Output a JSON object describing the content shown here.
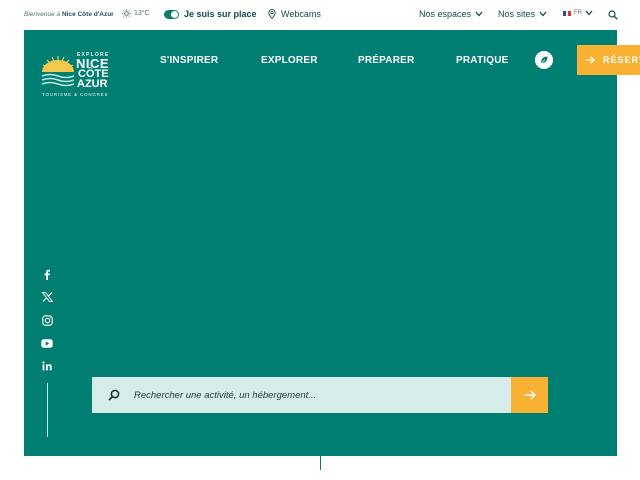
{
  "topbar": {
    "welcome_prefix": "Bienvenue à",
    "welcome_place": "Nice Côte d'Azur",
    "temperature": "13°C",
    "local_toggle": "Je suis sur place",
    "webcams": "Webcams",
    "spaces": "Nos espaces",
    "sites": "Nos sites",
    "lang": "FR"
  },
  "logo": {
    "explore": "EXPLORE",
    "nice": "NICE",
    "cote": "CÔTE",
    "azur": "AZUR",
    "tagline": "TOURISME & CONGRÈS"
  },
  "nav": {
    "items": [
      "S'INSPIRER",
      "EXPLORER",
      "PRÉPARER",
      "PRATIQUE"
    ],
    "book": "RÉSERV"
  },
  "search": {
    "placeholder": "Rechercher une activité, un hébergement..."
  },
  "social": [
    "facebook-icon",
    "x-icon",
    "instagram-icon",
    "youtube-icon",
    "linkedin-icon"
  ],
  "colors": {
    "hero": "#007e71",
    "accent": "#f8b133",
    "search_bg": "#d5ece8"
  }
}
